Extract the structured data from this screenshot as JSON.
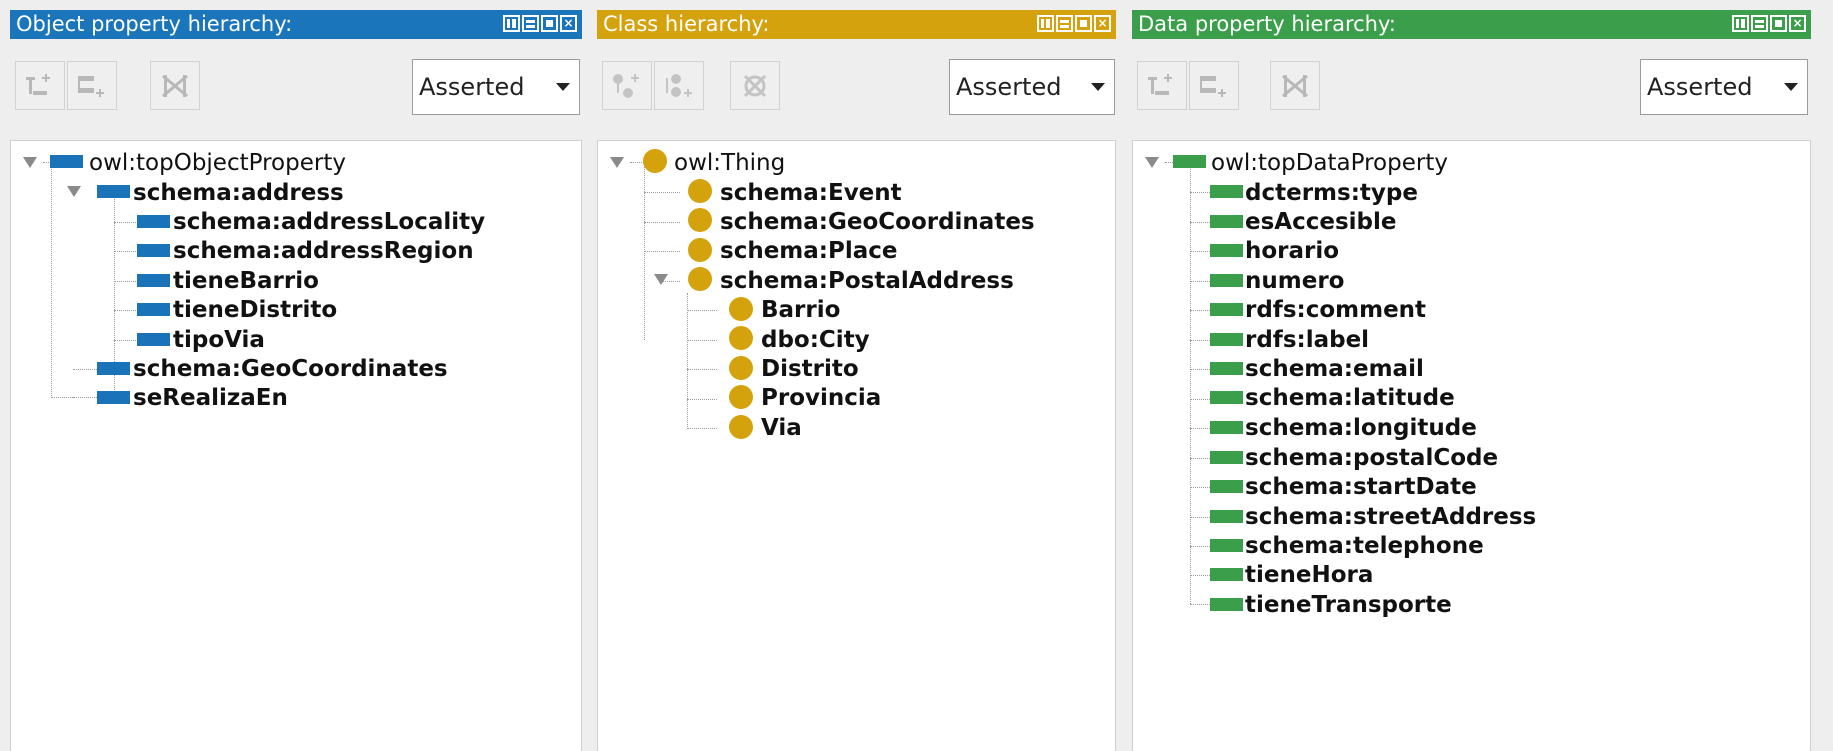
{
  "colors": {
    "object_accent": "#1b75bb",
    "class_accent": "#d4a20c",
    "data_accent": "#3a9e4a"
  },
  "object_panel": {
    "title": "Object property hierarchy:",
    "icons": [
      "add-subproperty-icon",
      "add-sibling-property-icon",
      "delete-property-icon"
    ],
    "view_mode": "Asserted",
    "root": "owl:topObjectProperty",
    "items": [
      "schema:address",
      "schema:addressLocality",
      "schema:addressRegion",
      "tieneBarrio",
      "tieneDistrito",
      "tipoVia",
      "schema:GeoCoordinates",
      "seRealizaEn"
    ]
  },
  "class_panel": {
    "title": "Class hierarchy:",
    "icons": [
      "add-subclass-icon",
      "add-sibling-class-icon",
      "delete-class-icon"
    ],
    "view_mode": "Asserted",
    "root": "owl:Thing",
    "items": [
      "schema:Event",
      "schema:GeoCoordinates",
      "schema:Place",
      "schema:PostalAddress",
      "Barrio",
      "dbo:City",
      "Distrito",
      "Provincia",
      "Via"
    ]
  },
  "data_panel": {
    "title": "Data property hierarchy:",
    "icons": [
      "add-subproperty-icon",
      "add-sibling-property-icon",
      "delete-property-icon"
    ],
    "view_mode": "Asserted",
    "root": "owl:topDataProperty",
    "items": [
      "dcterms:type",
      "esAccesible",
      "horario",
      "numero",
      "rdfs:comment",
      "rdfs:label",
      "schema:email",
      "schema:latitude",
      "schema:longitude",
      "schema:postalCode",
      "schema:startDate",
      "schema:streetAddress",
      "schema:telephone",
      "tieneHora",
      "tieneTransporte"
    ]
  }
}
